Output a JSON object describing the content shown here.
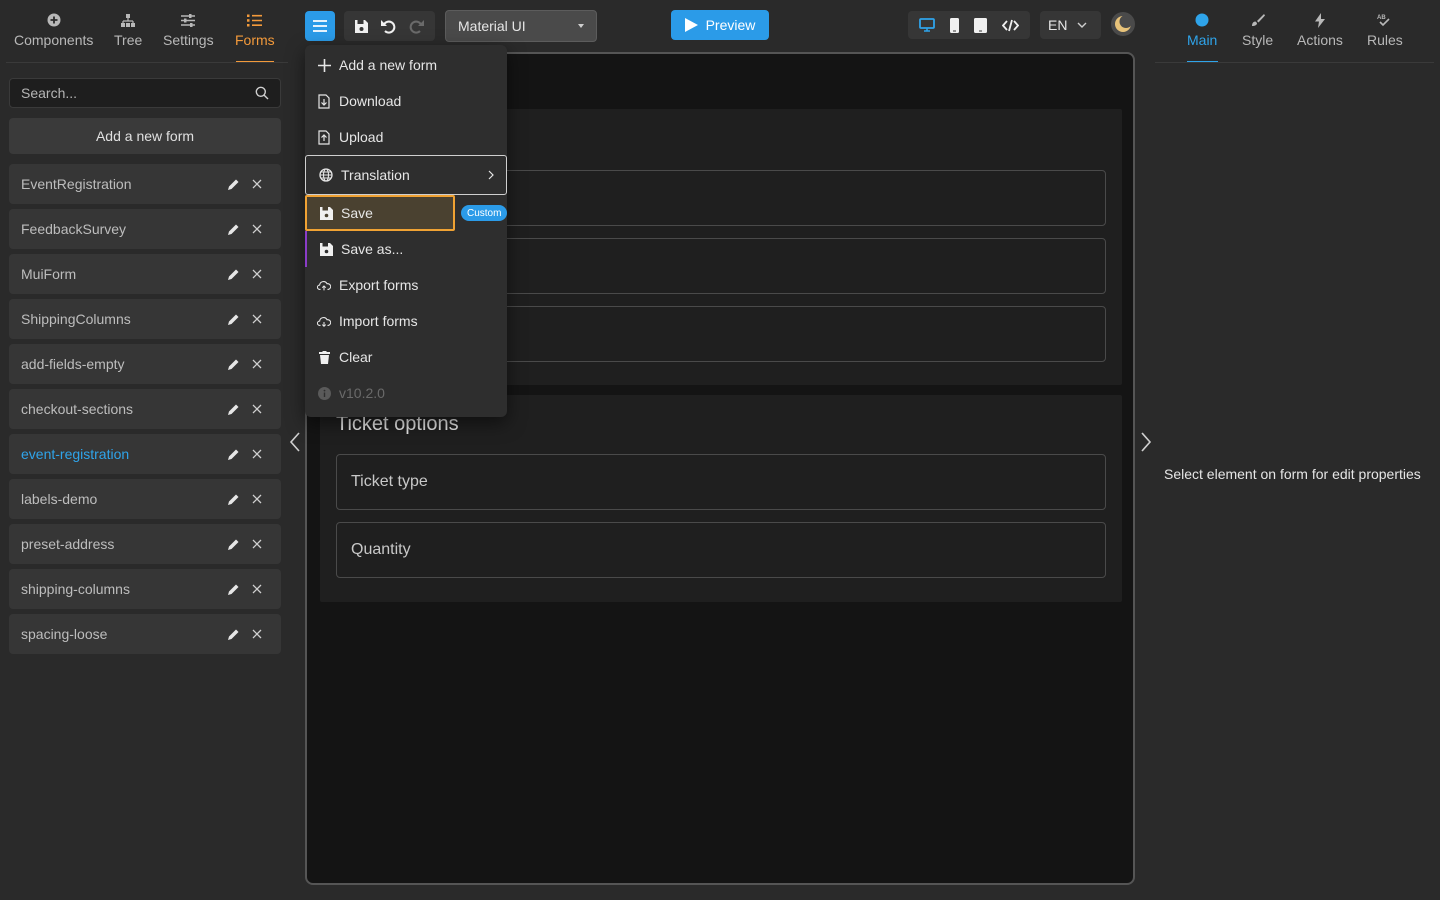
{
  "left_panel": {
    "tabs": [
      {
        "label": "Components",
        "icon": "plus-circle-icon"
      },
      {
        "label": "Tree",
        "icon": "tree-icon"
      },
      {
        "label": "Settings",
        "icon": "sliders-icon"
      },
      {
        "label": "Forms",
        "icon": "list-icon",
        "active": true
      }
    ],
    "search_placeholder": "Search...",
    "add_form_label": "Add a new form",
    "forms": [
      {
        "name": "EventRegistration"
      },
      {
        "name": "FeedbackSurvey"
      },
      {
        "name": "MuiForm"
      },
      {
        "name": "ShippingColumns"
      },
      {
        "name": "add-fields-empty"
      },
      {
        "name": "checkout-sections"
      },
      {
        "name": "event-registration",
        "active": true
      },
      {
        "name": "labels-demo"
      },
      {
        "name": "preset-address"
      },
      {
        "name": "shipping-columns"
      },
      {
        "name": "spacing-loose"
      }
    ]
  },
  "toolbar": {
    "ui_library": "Material UI",
    "preview_label": "Preview",
    "language": "EN"
  },
  "menu": {
    "items": [
      {
        "label": "Add a new form",
        "icon": "plus-icon"
      },
      {
        "label": "Download",
        "icon": "file-download-icon"
      },
      {
        "label": "Upload",
        "icon": "file-upload-icon"
      },
      {
        "label": "Translation",
        "icon": "globe-icon"
      },
      {
        "label": "Save",
        "icon": "floppy-icon"
      },
      {
        "label": "Save as...",
        "icon": "floppy-icon"
      },
      {
        "label": "Export forms",
        "icon": "cloud-upload-icon"
      },
      {
        "label": "Import forms",
        "icon": "cloud-download-icon"
      },
      {
        "label": "Clear",
        "icon": "trash-icon"
      },
      {
        "label": "v10.2.0",
        "icon": "info-icon"
      }
    ],
    "custom_badge": "Custom"
  },
  "canvas": {
    "section2_title": "Ticket options",
    "fields": [
      "Ticket type",
      "Quantity"
    ]
  },
  "right_panel": {
    "tabs": [
      {
        "label": "Main",
        "icon": "dot-icon",
        "active": true
      },
      {
        "label": "Style",
        "icon": "brush-icon"
      },
      {
        "label": "Actions",
        "icon": "bolt-icon"
      },
      {
        "label": "Rules",
        "icon": "rules-icon"
      }
    ],
    "hint": "Select element on form for edit properties"
  },
  "colors": {
    "accent_blue": "#2b9be8",
    "accent_orange": "#f39a3b",
    "background": "#2a2a2a",
    "canvas": "#141414"
  }
}
